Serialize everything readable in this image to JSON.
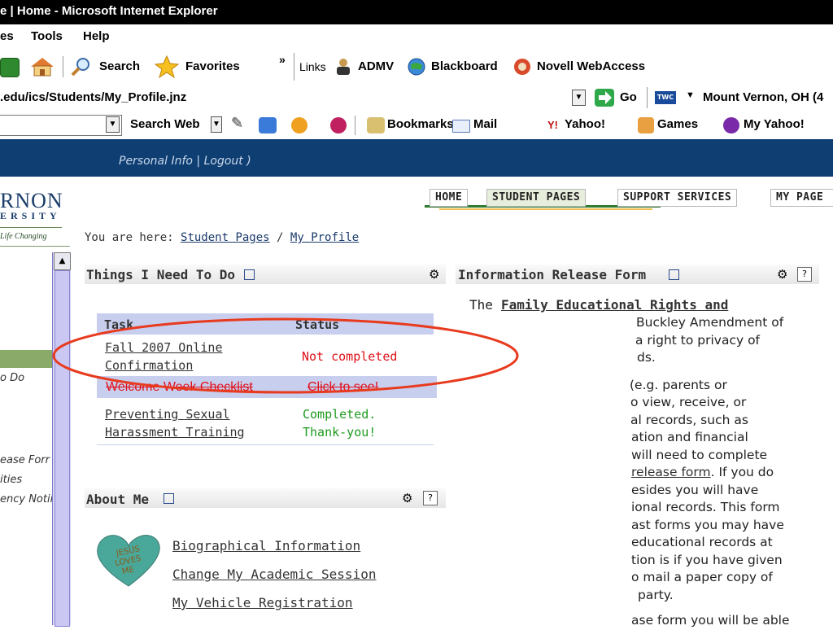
{
  "window": {
    "title": "e | Home - Microsoft Internet Explorer"
  },
  "menubar": {
    "items": [
      "es",
      "Tools",
      "Help"
    ]
  },
  "toolbar": {
    "search_label": "Search",
    "favorites_label": "Favorites",
    "chevron": "»",
    "links_label": "Links",
    "links": [
      "ADMV",
      "Blackboard",
      "Novell WebAccess"
    ]
  },
  "address": {
    "url": ".edu/ics/Students/My_Profile.jnz",
    "go_label": "Go",
    "weather_badge": "TWC",
    "weather_location": "Mount Vernon, OH (4"
  },
  "yahoobar": {
    "search_web_label": "Search Web",
    "bookmarks_label": "Bookmarks",
    "mail_label": "Mail",
    "yahoo_label": "Yahoo!",
    "games_label": "Games",
    "myyahoo_label": "My Yahoo!"
  },
  "site": {
    "header_text": "Personal Info  |  Logout )"
  },
  "nav": {
    "tabs": [
      "HOME",
      "STUDENT PAGES",
      "SUPPORT SERVICES",
      "MY PAGE"
    ]
  },
  "logo": {
    "line1": "RNON",
    "line2": "ERSITY",
    "line3": "Life Changing"
  },
  "sidebar": {
    "items": [
      "o Do",
      "ease Forr",
      "ities",
      "ency Notii"
    ]
  },
  "breadcrumb": {
    "prefix": "You are here:",
    "part1": "Student Pages",
    "sep": "/",
    "part2": "My Profile"
  },
  "things": {
    "title": "Things I Need To Do",
    "col_task": "Task",
    "col_status": "Status",
    "rows": [
      {
        "task1": "Fall 2007 Online",
        "task2": "Confirmation",
        "status": "Not completed"
      },
      {
        "task1": "Welcome Week Checklist",
        "status": "Click to see!"
      },
      {
        "task1": "Preventing Sexual",
        "task2": "Harassment Training",
        "status1": "Completed.",
        "status2": "Thank-you!"
      }
    ]
  },
  "about": {
    "title": "About Me",
    "heart_text": "JESUS LOVES ME",
    "links": [
      "Biographical Information",
      "Change My Academic Session",
      "My Vehicle Registration"
    ]
  },
  "info": {
    "title": "Information Release Form",
    "intro": "The",
    "intro_link": "Family Educational Rights and",
    "lines": [
      "Buckley Amendment of",
      "a right to privacy of",
      "ds.",
      "(e.g. parents or",
      "o view, receive, or",
      "al records, such as",
      "ation and financial",
      "will need to complete",
      "release form",
      ". If you do",
      "esides you will have",
      "ional records. This form",
      "ast forms you may have",
      "educational records at",
      "tion is if you have given",
      "o mail a paper copy of",
      "party.",
      "ase form you will be able"
    ]
  },
  "colors": {
    "header": "#0f3e73",
    "status_red": "#e0101a",
    "status_green": "#1e9a1e",
    "annotation": "#e83a1e",
    "highlight_row": "#c8cfee"
  }
}
